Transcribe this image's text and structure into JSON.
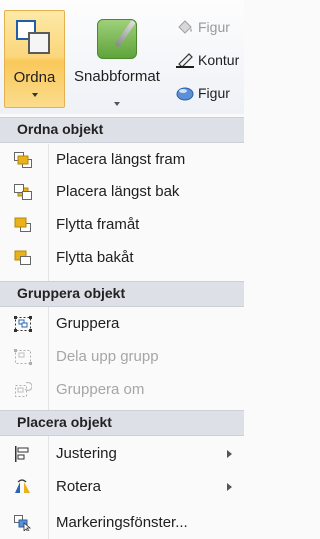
{
  "ribbon": {
    "ordna": {
      "label": "Ordna"
    },
    "snabbformat": {
      "label": "Snabbformat"
    },
    "shape_fill": {
      "label": "Figur"
    },
    "shape_outline": {
      "label": "Kontur"
    },
    "shape_effects": {
      "label": "Figur"
    }
  },
  "menu": {
    "sections": [
      {
        "title": "Ordna objekt",
        "items": [
          {
            "label": "Placera längst fram",
            "icon": "bring-to-front-icon",
            "disabled": false
          },
          {
            "label": "Placera längst bak",
            "icon": "send-to-back-icon",
            "disabled": false
          },
          {
            "label": "Flytta framåt",
            "icon": "bring-forward-icon",
            "disabled": false
          },
          {
            "label": "Flytta bakåt",
            "icon": "send-backward-icon",
            "disabled": false
          }
        ]
      },
      {
        "title": "Gruppera objekt",
        "items": [
          {
            "label": "Gruppera",
            "icon": "group-icon",
            "disabled": false
          },
          {
            "label": "Dela upp grupp",
            "icon": "ungroup-icon",
            "disabled": true
          },
          {
            "label": "Gruppera om",
            "icon": "regroup-icon",
            "disabled": true
          }
        ]
      },
      {
        "title": "Placera objekt",
        "items": [
          {
            "label": "Justering",
            "icon": "align-icon",
            "disabled": false,
            "submenu": true
          },
          {
            "label": "Rotera",
            "icon": "rotate-icon",
            "disabled": false,
            "submenu": true
          },
          {
            "label": "Markeringsfönster...",
            "icon": "selection-pane-icon",
            "disabled": false
          }
        ]
      }
    ]
  },
  "colors": {
    "accent_orange": "#fbd67c",
    "icon_gold": "#e9b21a",
    "icon_blue": "#2a64b3",
    "section_bg": "#dde1e7"
  }
}
